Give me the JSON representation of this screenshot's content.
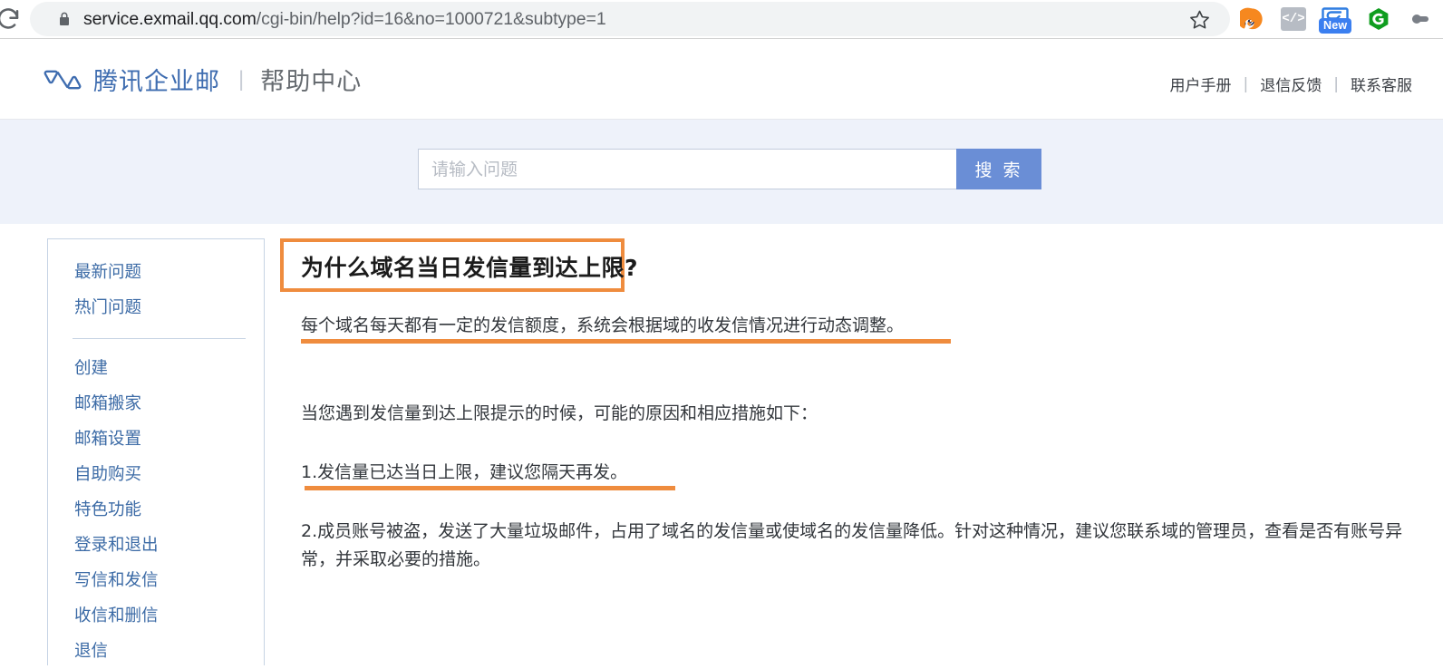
{
  "browser": {
    "reload_icon": "reload-icon",
    "lock_icon": "lock-icon",
    "url_host": "service.exmail.qq.com",
    "url_path": "/cgi-bin/help?id=16&no=1000721&subtype=1",
    "star_icon": "star-icon",
    "extensions": [
      {
        "name": "grammarly-extension-icon",
        "label": ""
      },
      {
        "name": "code-extension-icon",
        "label": "</>"
      },
      {
        "name": "new-extension-icon",
        "label": "New"
      },
      {
        "name": "grammarly-g-extension-icon",
        "label": "G"
      },
      {
        "name": "partial-extension-icon",
        "label": ""
      }
    ]
  },
  "header": {
    "logo_icon": "tencent-exmail-logo-icon",
    "brand": "腾讯企业邮",
    "separator": "|",
    "subtitle": "帮助中心",
    "nav": [
      {
        "label": "用户手册"
      },
      {
        "label": "退信反馈"
      },
      {
        "label": "联系客服"
      }
    ],
    "nav_separator": "|"
  },
  "search": {
    "placeholder": "请输入问题",
    "value": "",
    "button_label": "搜 索"
  },
  "sidebar": {
    "group_top": [
      {
        "label": "最新问题"
      },
      {
        "label": "热门问题"
      }
    ],
    "group_main": [
      {
        "label": "创建"
      },
      {
        "label": "邮箱搬家"
      },
      {
        "label": "邮箱设置"
      },
      {
        "label": "自助购买"
      },
      {
        "label": "特色功能"
      },
      {
        "label": "登录和退出"
      },
      {
        "label": "写信和发信"
      },
      {
        "label": "收信和删信"
      },
      {
        "label": "退信"
      }
    ]
  },
  "article": {
    "title": "为什么域名当日发信量到达上限?",
    "intro": "每个域名每天都有一定的发信额度，系统会根据域的收发信情况进行动态调整。",
    "lead_in": "当您遇到发信量到达上限提示的时候，可能的原因和相应措施如下：",
    "reason_1": "1.发信量已达当日上限，建议您隔天再发。",
    "reason_2": "2.成员账号被盗，发送了大量垃圾邮件，占用了域名的发信量或使域名的发信量降低。针对这种情况，建议您联系域的管理员，查看是否有账号异常，并采取必要的措施。"
  },
  "annotations": {
    "highlight_color": "#ef8c3e",
    "title_box": "orange-rectangle-around-title",
    "underline_intro": "orange-underline-intro",
    "underline_reason_1": "orange-underline-reason-1"
  },
  "colors": {
    "brand_blue": "#3f6db0",
    "link_blue": "#3c6ba6",
    "search_button": "#6a8ed6",
    "band_background": "#eef2fa",
    "accent_orange": "#ef8c3e"
  }
}
